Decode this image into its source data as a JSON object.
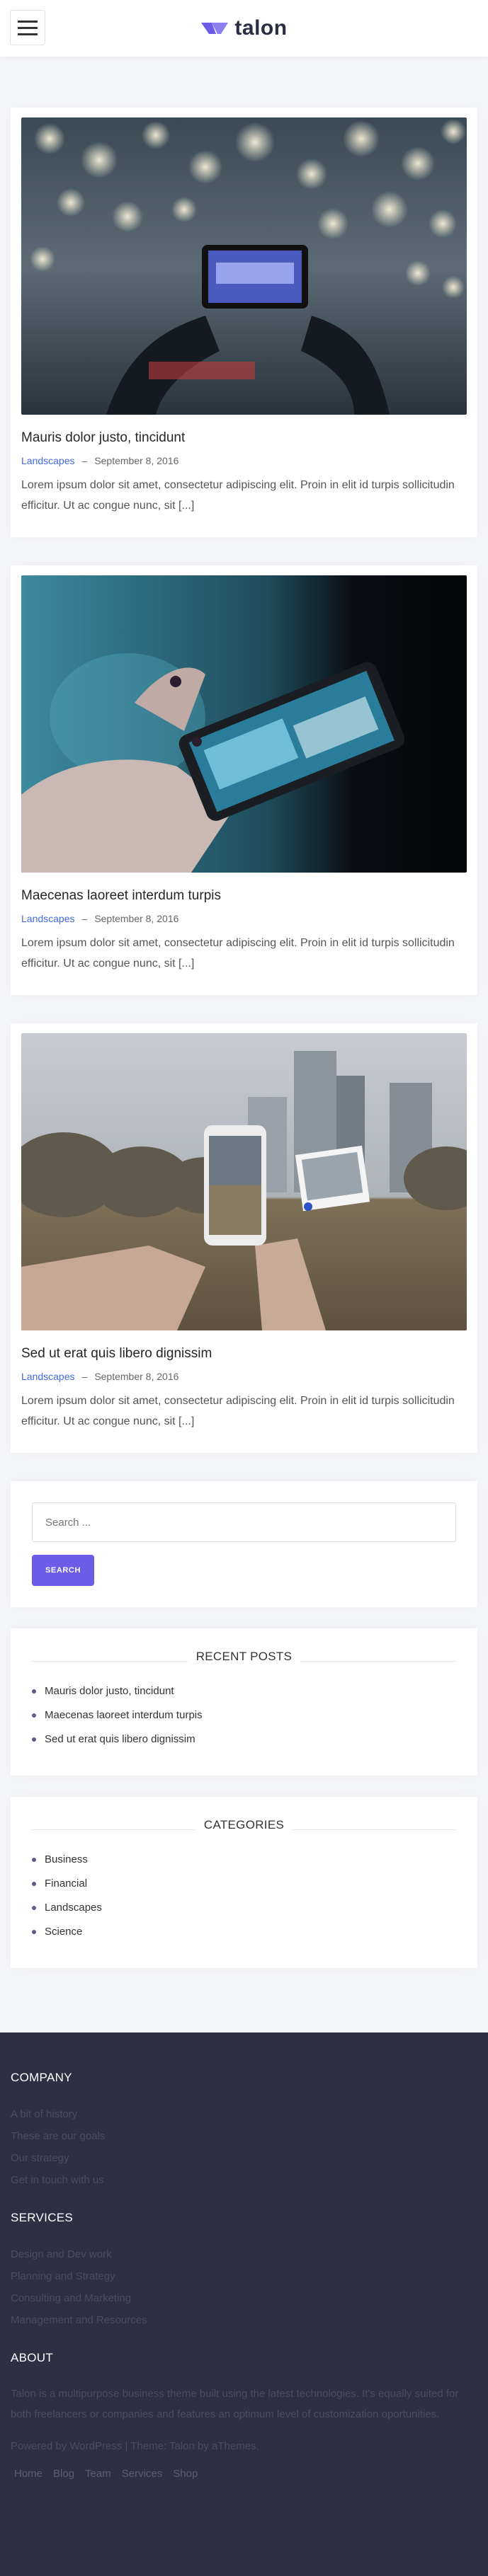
{
  "header": {
    "brand": "talon",
    "menu_icon": "hamburger-icon",
    "logo_icon": "talon-logo-icon",
    "accent": "#6c5ce7"
  },
  "posts": [
    {
      "title": "Mauris dolor justo, tincidunt",
      "category": "Landscapes",
      "separator": "–",
      "date": "September 8, 2016",
      "excerpt": "Lorem ipsum dolor sit amet, consectetur adipiscing elit. Proin in elit id turpis sollicitudin efficitur. Ut ac congue nunc, sit [...]"
    },
    {
      "title": "Maecenas laoreet interdum turpis",
      "category": "Landscapes",
      "separator": "–",
      "date": "September 8, 2016",
      "excerpt": "Lorem ipsum dolor sit amet, consectetur adipiscing elit. Proin in elit id turpis sollicitudin efficitur. Ut ac congue nunc, sit [...]"
    },
    {
      "title": "Sed ut erat quis libero dignissim",
      "category": "Landscapes",
      "separator": "–",
      "date": "September 8, 2016",
      "excerpt": "Lorem ipsum dolor sit amet, consectetur adipiscing elit. Proin in elit id turpis sollicitudin efficitur. Ut ac congue nunc, sit [...]"
    }
  ],
  "search": {
    "placeholder": "Search ...",
    "button": "SEARCH"
  },
  "recent_posts": {
    "title": "RECENT POSTS",
    "items": [
      "Mauris dolor justo, tincidunt",
      "Maecenas laoreet interdum turpis",
      "Sed ut erat quis libero dignissim"
    ]
  },
  "categories": {
    "title": "CATEGORIES",
    "items": [
      "Business",
      "Financial",
      "Landscapes",
      "Science"
    ]
  },
  "footer": {
    "company": {
      "title": "COMPANY",
      "items": [
        "A bit of history",
        "These are our goals",
        "Our strategy",
        "Get in touch with us"
      ]
    },
    "services": {
      "title": "SERVICES",
      "items": [
        "Design and Dev work",
        "Planning and Strategy",
        "Consulting and Marketing",
        "Management and Resources"
      ]
    },
    "about": {
      "title": "ABOUT",
      "text": "Talon is a multipurpose business theme built using the latest technologies. It's equally suited for both freelancers or companies and features an optimum level of customization oportunities."
    },
    "credit": "Powered by WordPress | Theme: Talon by aThemes.",
    "nav": [
      "Home",
      "Blog",
      "Team",
      "Services",
      "Shop"
    ]
  }
}
